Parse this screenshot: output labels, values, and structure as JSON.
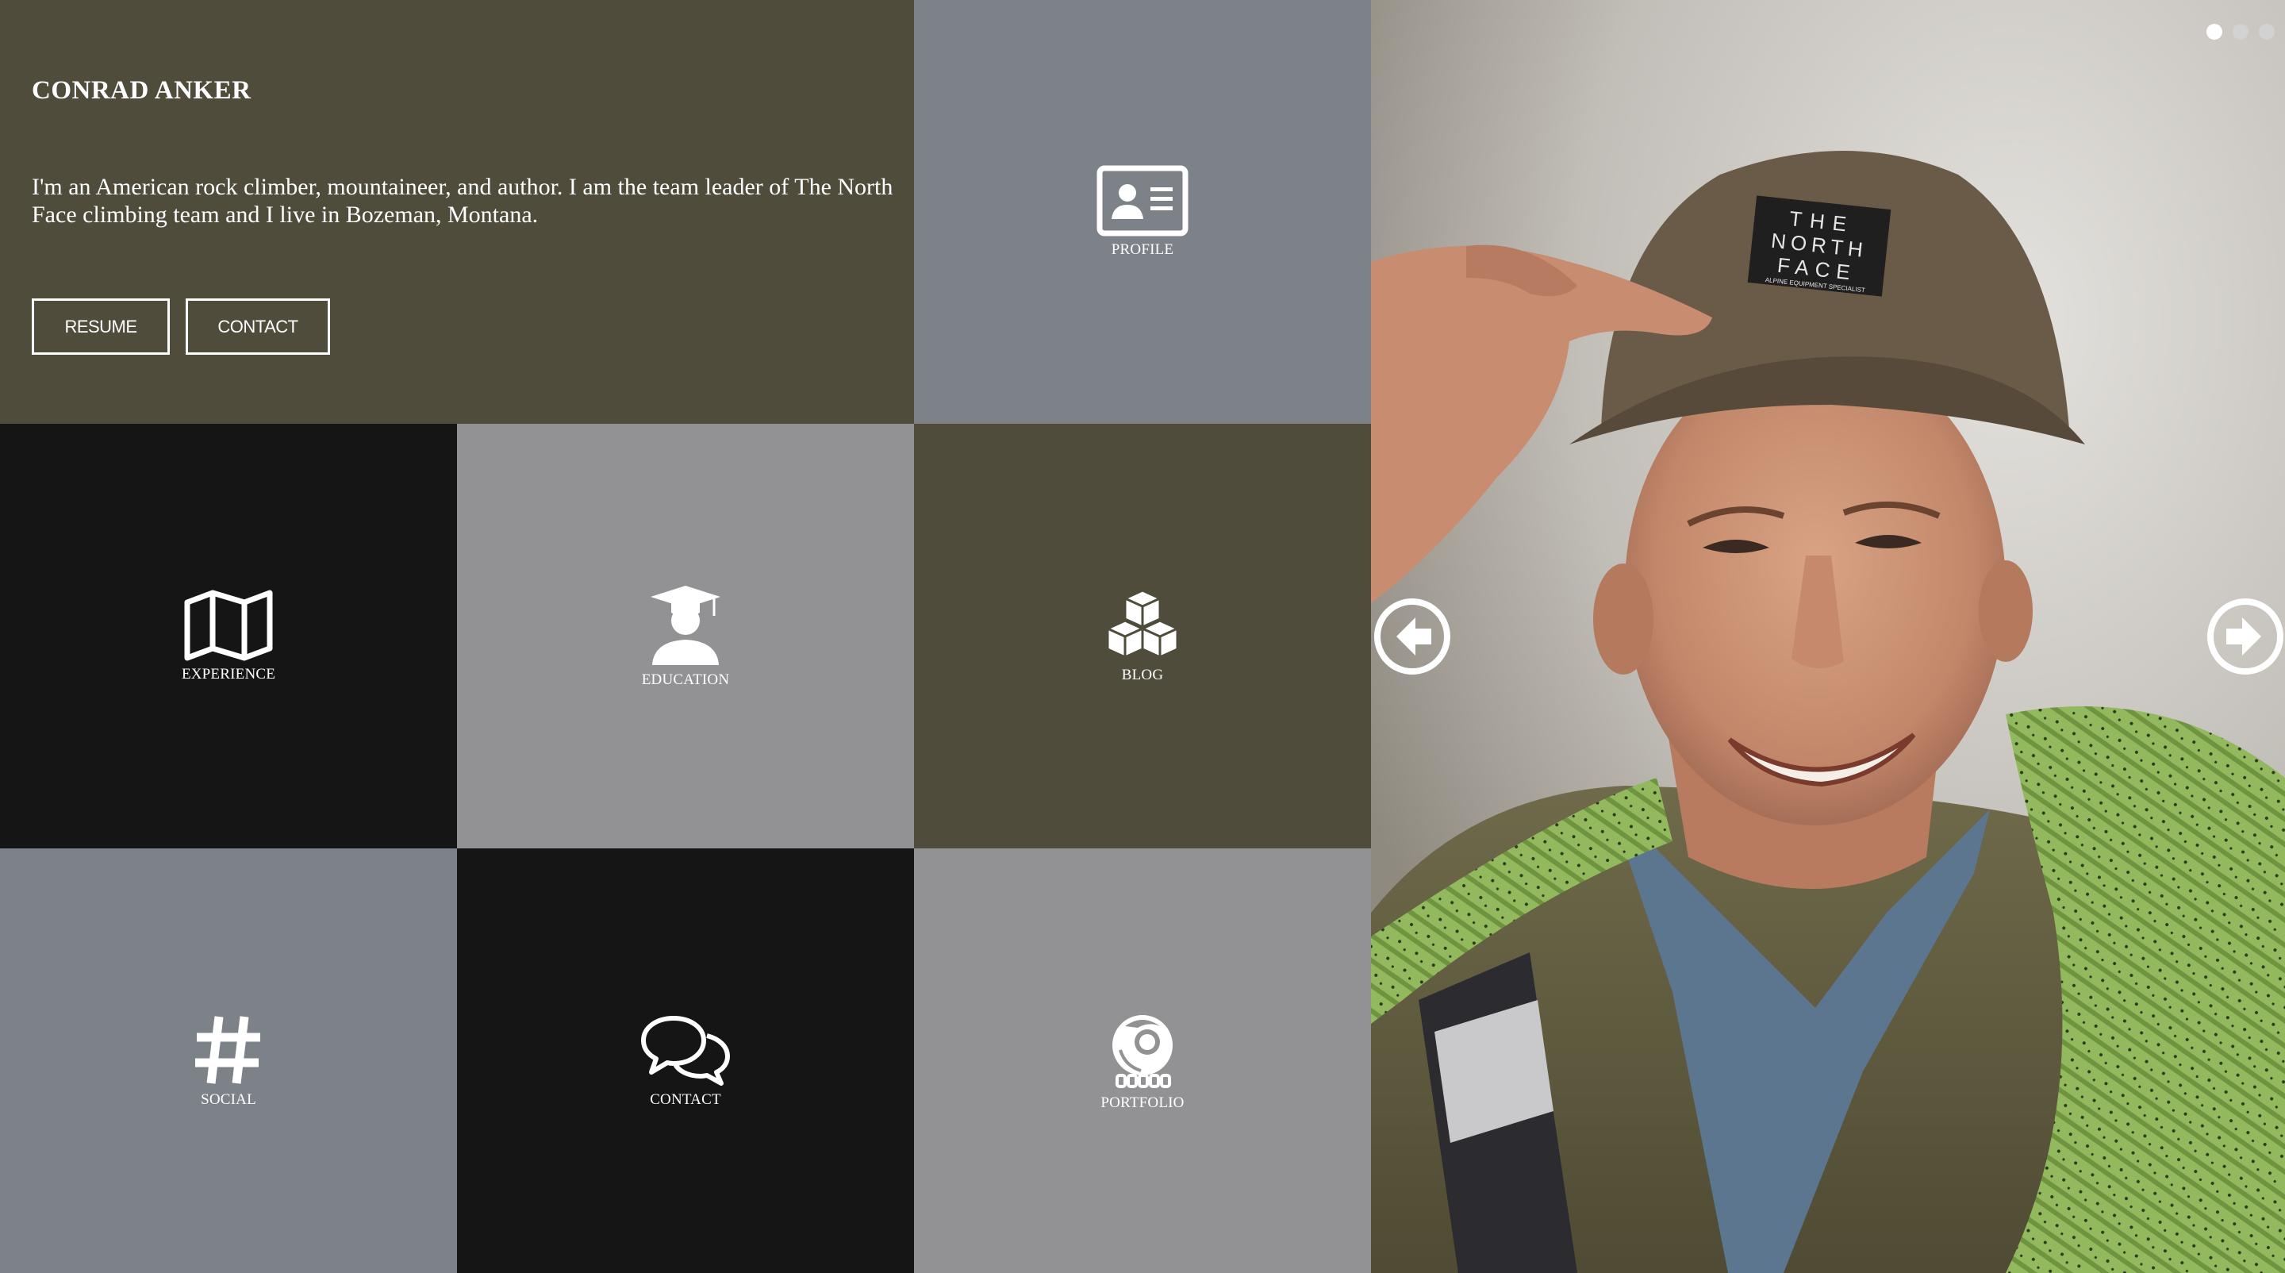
{
  "intro": {
    "name": "CONRAD ANKER",
    "bio": "I'm an American rock climber, mountaineer, and author. I am the team leader of The North Face climbing team and I live in Bozeman, Montana.",
    "buttons": {
      "resume": "RESUME",
      "contact": "CONTACT"
    }
  },
  "tiles": {
    "profile": {
      "label": "PROFILE",
      "icon": "id-card-icon"
    },
    "experience": {
      "label": "EXPERIENCE",
      "icon": "map-icon"
    },
    "education": {
      "label": "EDUCATION",
      "icon": "graduate-icon"
    },
    "blog": {
      "label": "BLOG",
      "icon": "cubes-icon"
    },
    "social": {
      "label": "SOCIAL",
      "icon": "hashtag-icon"
    },
    "contact": {
      "label": "CONTACT",
      "icon": "chat-bubbles-icon"
    },
    "portfolio": {
      "label": "PORTFOLIO",
      "icon": "portfolio-logo-icon"
    }
  },
  "slider": {
    "slide_count": 3,
    "active_slide": 1,
    "cap_text": [
      "THE",
      "NORTH",
      "FACE"
    ],
    "cap_subtext": "ALPINE EQUIPMENT SPECIALIST"
  },
  "colors": {
    "olive": "#4f4c3c",
    "slate": "#7d8188",
    "black": "#151515",
    "gray": "#929194",
    "rope_green": "#8db45b"
  }
}
